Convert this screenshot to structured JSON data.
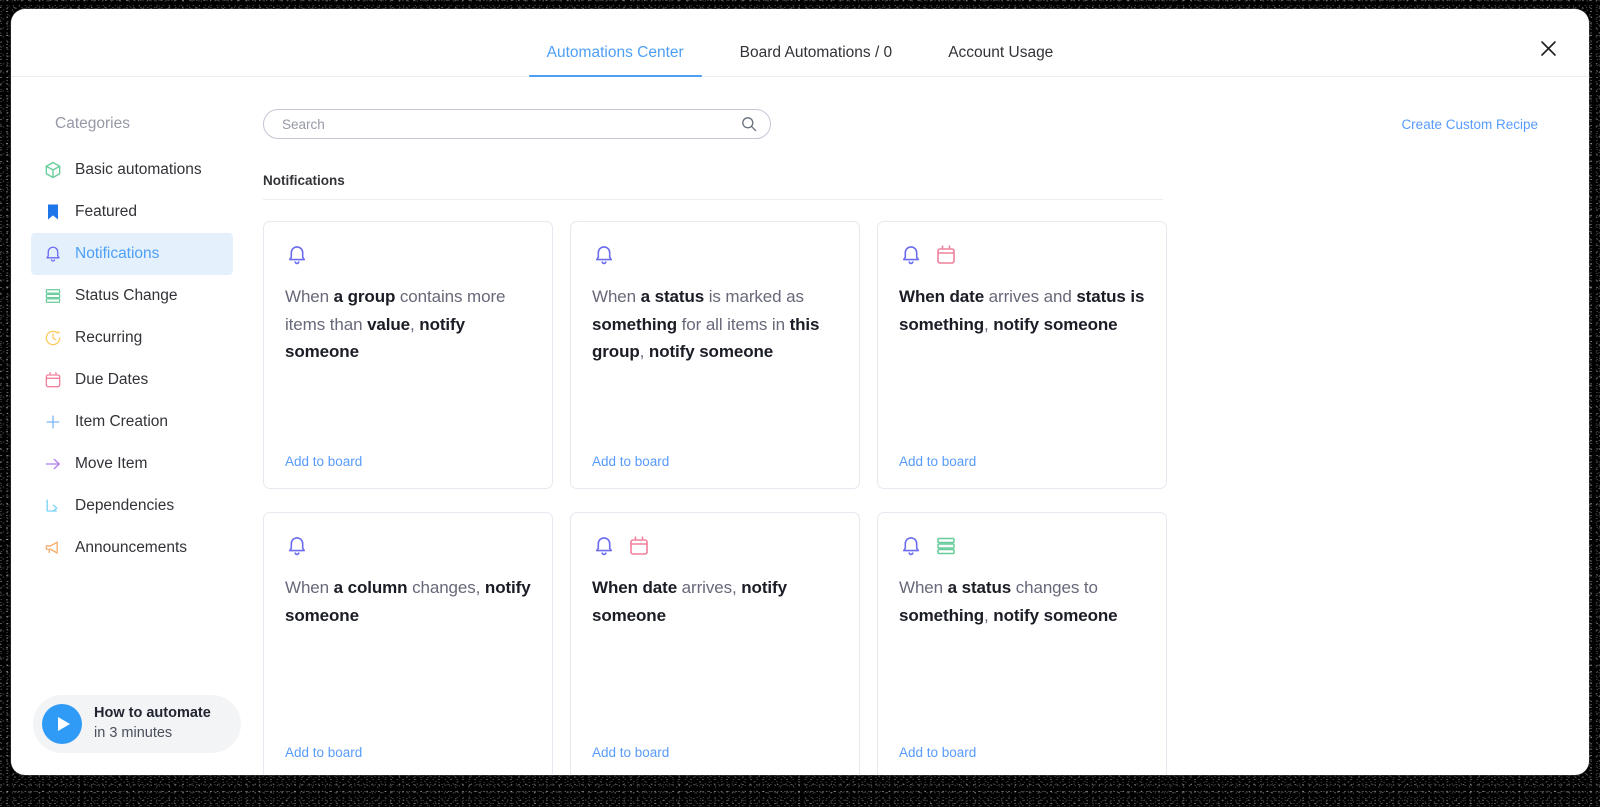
{
  "header": {
    "tabs": [
      {
        "label": "Automations Center",
        "active": true
      },
      {
        "label": "Board Automations / 0",
        "active": false
      },
      {
        "label": "Account Usage",
        "active": false
      }
    ],
    "close_icon": "close-icon"
  },
  "sidebar": {
    "title": "Categories",
    "items": [
      {
        "label": "Basic automations",
        "icon": "cube-icon",
        "color": "#66cc99",
        "active": false
      },
      {
        "label": "Featured",
        "icon": "bookmark-icon",
        "color": "#1f76e8",
        "active": false
      },
      {
        "label": "Notifications",
        "icon": "bell-icon",
        "color": "#6c6cef",
        "active": true
      },
      {
        "label": "Status Change",
        "icon": "status-bars-icon",
        "color": "#66cc99",
        "active": false
      },
      {
        "label": "Recurring",
        "icon": "clock-icon",
        "color": "#ffcb63",
        "active": false
      },
      {
        "label": "Due Dates",
        "icon": "calendar-icon",
        "color": "#f1809c",
        "active": false
      },
      {
        "label": "Item Creation",
        "icon": "plus-icon",
        "color": "#7cb7f7",
        "active": false
      },
      {
        "label": "Move Item",
        "icon": "arrow-right-icon",
        "color": "#b07ff0",
        "active": false
      },
      {
        "label": "Dependencies",
        "icon": "dependency-icon",
        "color": "#79d4f5",
        "active": false
      },
      {
        "label": "Announcements",
        "icon": "megaphone-icon",
        "color": "#f6ac6a",
        "active": false
      }
    ],
    "video": {
      "icon": "play-icon",
      "line1": "How to automate",
      "line2": "in 3 minutes"
    }
  },
  "main": {
    "search": {
      "placeholder": "Search",
      "value": "",
      "icon": "search-icon"
    },
    "create_recipe_label": "Create Custom Recipe",
    "section_title": "Notifications",
    "add_to_board_label": "Add to board",
    "cards": [
      {
        "icons": [
          "bell-icon"
        ],
        "segments": [
          {
            "text": "When ",
            "bold": false
          },
          {
            "text": "a group",
            "bold": true
          },
          {
            "text": " contains more items than ",
            "bold": false
          },
          {
            "text": "value",
            "bold": true
          },
          {
            "text": ", ",
            "bold": false
          },
          {
            "text": "notify someone",
            "bold": true
          }
        ],
        "action": "Add to board"
      },
      {
        "icons": [
          "bell-icon"
        ],
        "segments": [
          {
            "text": "When ",
            "bold": false
          },
          {
            "text": "a status",
            "bold": true
          },
          {
            "text": " is marked as ",
            "bold": false
          },
          {
            "text": "something",
            "bold": true
          },
          {
            "text": " for all items in ",
            "bold": false
          },
          {
            "text": "this group",
            "bold": true
          },
          {
            "text": ", ",
            "bold": false
          },
          {
            "text": "notify someone",
            "bold": true
          }
        ],
        "action": "Add to board"
      },
      {
        "icons": [
          "bell-icon",
          "calendar-icon"
        ],
        "segments": [
          {
            "text": "When ",
            "bold": true
          },
          {
            "text": "date",
            "bold": true
          },
          {
            "text": " arrives and ",
            "bold": false
          },
          {
            "text": "status is something",
            "bold": true
          },
          {
            "text": ", ",
            "bold": false
          },
          {
            "text": "notify someone",
            "bold": true
          }
        ],
        "action": "Add to board"
      },
      {
        "icons": [
          "bell-icon"
        ],
        "segments": [
          {
            "text": "When ",
            "bold": false
          },
          {
            "text": "a column",
            "bold": true
          },
          {
            "text": " changes, ",
            "bold": false
          },
          {
            "text": "notify someone",
            "bold": true
          }
        ],
        "action": "Add to board"
      },
      {
        "icons": [
          "bell-icon",
          "calendar-icon"
        ],
        "segments": [
          {
            "text": "When ",
            "bold": true
          },
          {
            "text": "date",
            "bold": true
          },
          {
            "text": " arrives, ",
            "bold": false
          },
          {
            "text": "notify someone",
            "bold": true
          }
        ],
        "action": "Add to board"
      },
      {
        "icons": [
          "bell-icon",
          "status-bars-icon"
        ],
        "segments": [
          {
            "text": "When ",
            "bold": false
          },
          {
            "text": "a status",
            "bold": true
          },
          {
            "text": " changes to ",
            "bold": false
          },
          {
            "text": "something",
            "bold": true
          },
          {
            "text": ", ",
            "bold": false
          },
          {
            "text": "notify someone",
            "bold": true
          }
        ],
        "action": "Add to board"
      }
    ]
  },
  "colors": {
    "accent_blue": "#579bfc",
    "tab_active": "#4d9ff5",
    "active_bg": "#e4f1fd",
    "bell_purple": "#6c6cef",
    "calendar_pink": "#f1809c",
    "status_green": "#66cc99",
    "text_dark": "#1b1d26",
    "text_gray": "#676879"
  }
}
